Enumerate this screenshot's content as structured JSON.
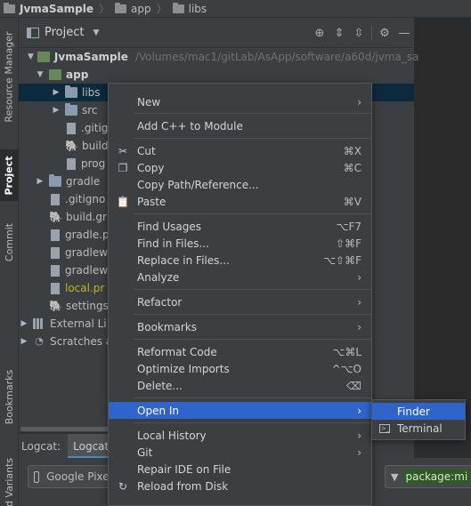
{
  "breadcrumb": [
    "JvmaSample",
    "app",
    "libs"
  ],
  "left_tabs": [
    "Resource Manager",
    "Project",
    "Commit",
    "Bookmarks",
    "ild Variants"
  ],
  "panel": {
    "title": "Project",
    "tools": [
      "locate-icon",
      "expand-all-icon",
      "collapse-all-icon",
      "gear-icon",
      "minimize-icon"
    ]
  },
  "tree": [
    {
      "label": "JvmaSample",
      "extra": "/Volumes/mac1/gitLab/AsApp/software/a60d/jvma_sa",
      "icon": "module"
    },
    {
      "label": "app",
      "icon": "module"
    },
    {
      "label": "libs",
      "icon": "folder"
    },
    {
      "label": "src",
      "icon": "folder"
    },
    {
      "label": ".gitig",
      "icon": "file"
    },
    {
      "label": "build",
      "icon": "gradle"
    },
    {
      "label": "prog",
      "icon": "file"
    },
    {
      "label": "gradle",
      "icon": "folder"
    },
    {
      "label": ".gitigno",
      "icon": "file"
    },
    {
      "label": "build.gr",
      "icon": "gradle"
    },
    {
      "label": "gradle.p",
      "icon": "file"
    },
    {
      "label": "gradlew",
      "icon": "file"
    },
    {
      "label": "gradlew",
      "icon": "file"
    },
    {
      "label": "local.pr",
      "icon": "file"
    },
    {
      "label": "settings",
      "icon": "gradle"
    },
    {
      "label": "External Li",
      "icon": "libraries"
    },
    {
      "label": "Scratches a",
      "icon": "scratch"
    }
  ],
  "logcat": {
    "label": "Logcat:",
    "tab": "Logcat",
    "device": "Google Pixel",
    "filter": "package:mi"
  },
  "menu": {
    "items": [
      {
        "label": "New",
        "shortcut": "",
        "submenu": true,
        "icon": ""
      },
      {
        "label": "Add C++ to Module",
        "shortcut": "",
        "submenu": false,
        "icon": ""
      },
      {
        "label": "Cut",
        "shortcut": "⌘X",
        "submenu": false,
        "icon": "scissors-icon"
      },
      {
        "label": "Copy",
        "shortcut": "⌘C",
        "submenu": false,
        "icon": "copy-icon"
      },
      {
        "label": "Copy Path/Reference...",
        "shortcut": "",
        "submenu": false,
        "icon": ""
      },
      {
        "label": "Paste",
        "shortcut": "⌘V",
        "submenu": false,
        "icon": "paste-icon"
      },
      {
        "label": "Find Usages",
        "shortcut": "⌥F7",
        "submenu": false,
        "icon": ""
      },
      {
        "label": "Find in Files...",
        "shortcut": "⇧⌘F",
        "submenu": false,
        "icon": ""
      },
      {
        "label": "Replace in Files...",
        "shortcut": "⌥⇧⌘F",
        "submenu": false,
        "icon": ""
      },
      {
        "label": "Analyze",
        "shortcut": "",
        "submenu": true,
        "icon": ""
      },
      {
        "label": "Refactor",
        "shortcut": "",
        "submenu": true,
        "icon": ""
      },
      {
        "label": "Bookmarks",
        "shortcut": "",
        "submenu": true,
        "icon": ""
      },
      {
        "label": "Reformat Code",
        "shortcut": "⌥⌘L",
        "submenu": false,
        "icon": ""
      },
      {
        "label": "Optimize Imports",
        "shortcut": "^⌥O",
        "submenu": false,
        "icon": ""
      },
      {
        "label": "Delete...",
        "shortcut": "⌫",
        "submenu": false,
        "icon": ""
      },
      {
        "label": "Open In",
        "shortcut": "",
        "submenu": true,
        "icon": ""
      },
      {
        "label": "Local History",
        "shortcut": "",
        "submenu": true,
        "icon": ""
      },
      {
        "label": "Git",
        "shortcut": "",
        "submenu": true,
        "icon": ""
      },
      {
        "label": "Repair IDE on File",
        "shortcut": "",
        "submenu": false,
        "icon": ""
      },
      {
        "label": "Reload from Disk",
        "shortcut": "",
        "submenu": false,
        "icon": "reload-icon"
      }
    ]
  },
  "submenu": {
    "items": [
      {
        "label": "Finder",
        "icon": ""
      },
      {
        "label": "Terminal",
        "icon": "terminal-icon"
      }
    ]
  },
  "colors": {
    "background": "#2b2d30",
    "panel": "#3c3f41",
    "selection": "#2f65ca",
    "tree_selection": "#0d293e"
  }
}
